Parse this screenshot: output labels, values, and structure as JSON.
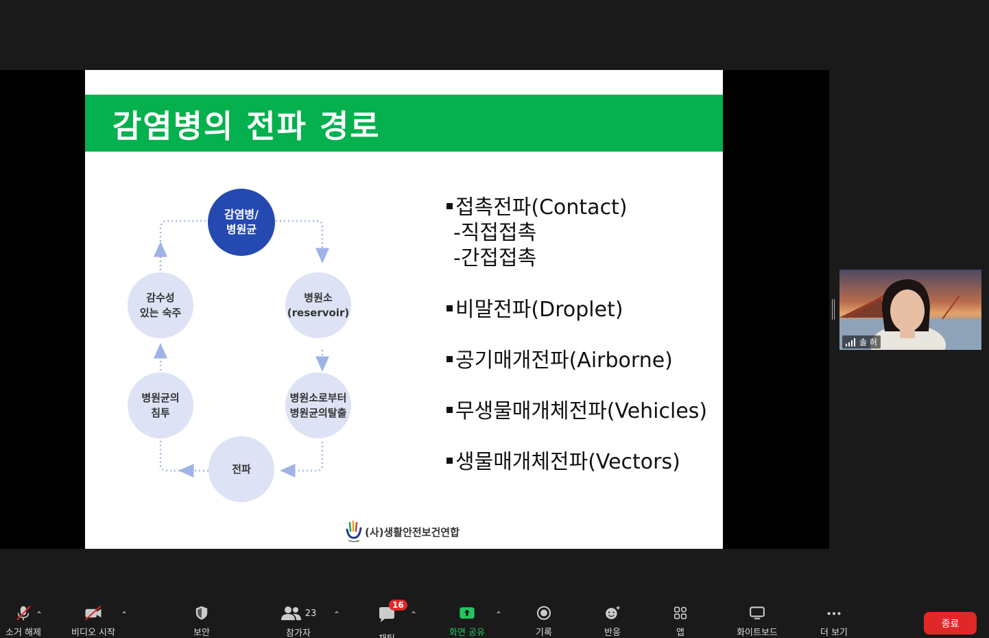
{
  "slide": {
    "title": "감염병의 전파 경로",
    "cycle_nodes": {
      "top_line1": "감염병/",
      "top_line2": "병원균",
      "right_top_line1": "병원소",
      "right_top_line2": "(reservoir)",
      "right_bottom_line1": "병원소로부터",
      "right_bottom_line2": "병원균의탈출",
      "bottom": "전파",
      "left_bottom_line1": "병원균의",
      "left_bottom_line2": "침투",
      "left_top_line1": "감수성",
      "left_top_line2": "있는 숙주"
    },
    "bullets": {
      "contact": "접촉전파(Contact)",
      "contact_sub1": "-직접접촉",
      "contact_sub2": "-간접접촉",
      "droplet": "비말전파(Droplet)",
      "airborne": "공기매개전파(Airborne)",
      "vehicles": "무생물매개체전파(Vehicles)",
      "vectors": "생물매개체전파(Vectors)"
    },
    "org_name": "(사)생활안전보건연합"
  },
  "participant": {
    "name": "솔 허"
  },
  "toolbar": {
    "mute": "소거 해제",
    "video": "비디오 시작",
    "security": "보안",
    "participants": "참가자",
    "participants_count": "23",
    "chat": "채팅",
    "chat_badge": "16",
    "share": "화면 공유",
    "record": "기록",
    "reactions": "반응",
    "apps": "앱",
    "whiteboard": "화이트보드",
    "more": "더 보기",
    "end": "종료"
  },
  "colors": {
    "header_green": "#05b04e",
    "node_dark_blue": "#2449b1",
    "node_light": "#dde3f5",
    "end_red": "#e02828",
    "share_green": "#22c55e"
  }
}
